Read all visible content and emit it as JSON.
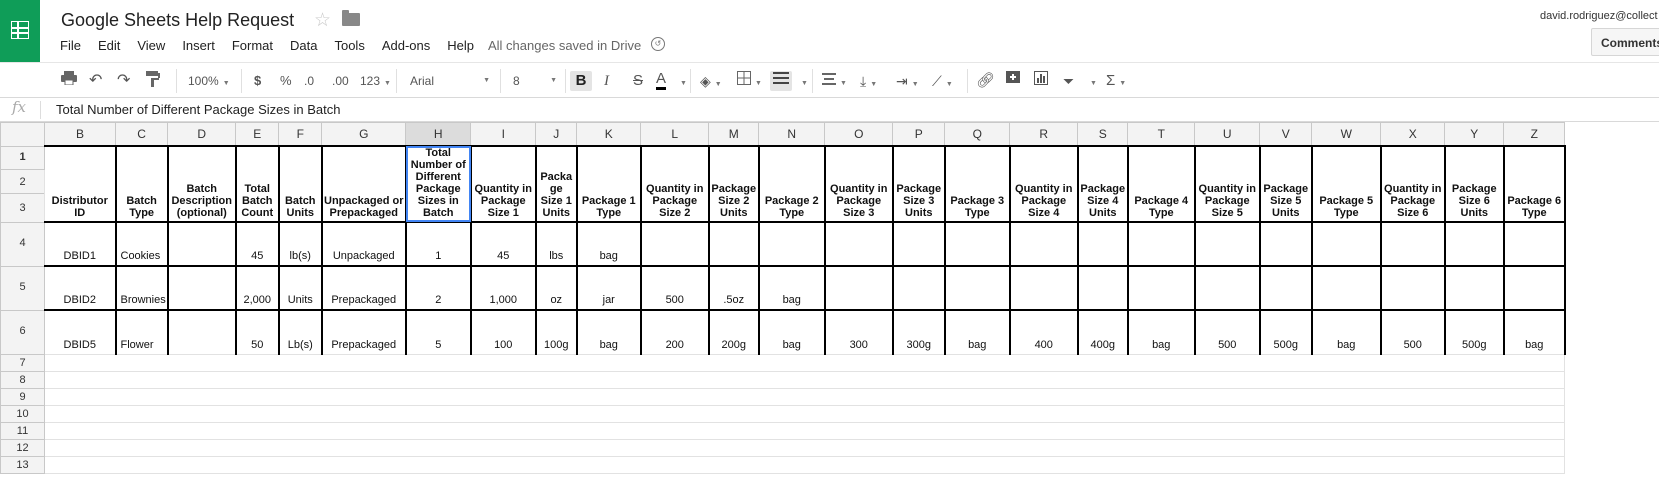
{
  "app": {
    "title": "Google Sheets Help Request",
    "user": "david.rodriguez@collect",
    "comments_label": "Comments",
    "status": "All changes saved in Drive",
    "menu": [
      "File",
      "Edit",
      "View",
      "Insert",
      "Format",
      "Data",
      "Tools",
      "Add-ons",
      "Help"
    ]
  },
  "toolbar": {
    "zoom": "100%",
    "currency": "$",
    "percent": "%",
    "decrease_decimal": ".0",
    "increase_decimal": ".00",
    "more_formats": "123",
    "font": "Arial",
    "font_size": "8",
    "bold": "B",
    "italic": "I",
    "strike": "S",
    "text_color": "A",
    "functions": "Σ"
  },
  "formula_bar": {
    "label": "fx",
    "value": "Total Number of Different Package Sizes in Batch"
  },
  "sheet": {
    "columns": [
      "B",
      "C",
      "D",
      "E",
      "F",
      "G",
      "H",
      "I",
      "J",
      "K",
      "L",
      "M",
      "N",
      "O",
      "P",
      "Q",
      "R",
      "S",
      "T",
      "U",
      "V",
      "W",
      "X",
      "Y",
      "Z"
    ],
    "selected_column": "H",
    "row_numbers": [
      "1",
      "2",
      "3",
      "4",
      "5",
      "6",
      "7",
      "8",
      "9",
      "10",
      "11",
      "12",
      "13"
    ],
    "headers": [
      "Distributor ID",
      "Batch Type",
      "Batch Description (optional)",
      "Total Batch Count",
      "Batch Units",
      "Unpackaged or Prepackaged",
      "Total Number of Different Package Sizes in Batch",
      "Quantity in Package Size 1",
      "Packa ge Size 1 Units",
      "Package 1 Type",
      "Quantity in Package Size 2",
      "Package Size 2 Units",
      "Package 2 Type",
      "Quantity in Package Size 3",
      "Package Size 3 Units",
      "Package 3 Type",
      "Quantity in Package Size 4",
      "Package Size 4 Units",
      "Package 4 Type",
      "Quantity in Package Size 5",
      "Package Size 5 Units",
      "Package 5 Type",
      "Quantity in Package Size 6",
      "Package Size 6 Units",
      "Package 6 Type"
    ],
    "rows": [
      [
        "DBID1",
        "Cookies",
        "",
        "45",
        "lb(s)",
        "Unpackaged",
        "1",
        "45",
        "lbs",
        "bag",
        "",
        "",
        "",
        "",
        "",
        "",
        "",
        "",
        "",
        "",
        "",
        "",
        "",
        "",
        ""
      ],
      [
        "DBID2",
        "Brownies",
        "",
        "2,000",
        "Units",
        "Prepackaged",
        "2",
        "1,000",
        "oz",
        "jar",
        "500",
        ".5oz",
        "bag",
        "",
        "",
        "",
        "",
        "",
        "",
        "",
        "",
        "",
        "",
        "",
        ""
      ],
      [
        "DBID5",
        "Flower",
        "",
        "50",
        "Lb(s)",
        "Prepackaged",
        "5",
        "100",
        "100g",
        "bag",
        "200",
        "200g",
        "bag",
        "300",
        "300g",
        "bag",
        "400",
        "400g",
        "bag",
        "500",
        "500g",
        "bag",
        "500",
        "500g",
        "bag"
      ]
    ]
  }
}
